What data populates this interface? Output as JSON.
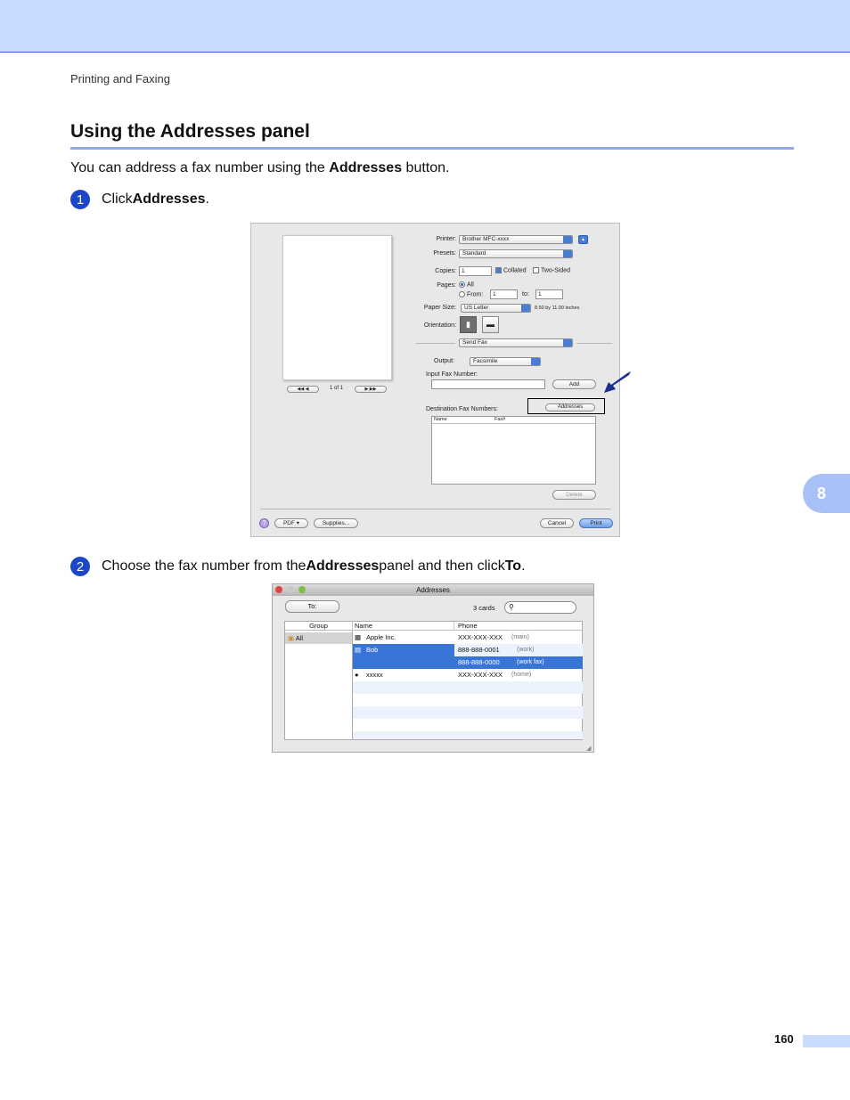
{
  "header": {
    "running_head": "Printing and Faxing"
  },
  "section": {
    "title": "Using the Addresses panel",
    "intro_pre": "You can address a fax number using the ",
    "intro_bold": "Addresses",
    "intro_post": " button."
  },
  "steps": [
    {
      "num": "1",
      "pre": "Click ",
      "bold": "Addresses",
      "post": "."
    },
    {
      "num": "2",
      "pre": "Choose the fax number from the ",
      "bold": "Addresses",
      "mid": " panel and then click ",
      "bold2": "To",
      "post": "."
    }
  ],
  "print_dialog": {
    "printer_label": "Printer:",
    "printer_value": "Brother MFC-xxxx",
    "presets_label": "Presets:",
    "presets_value": "Standard",
    "copies_label": "Copies:",
    "copies_value": "1",
    "collated": "Collated",
    "two_sided": "Two-Sided",
    "pages_label": "Pages:",
    "pages_all": "All",
    "pages_from": "From:",
    "from_value": "1",
    "to_label": "to:",
    "to_value": "1",
    "paper_label": "Paper Size:",
    "paper_value": "US Letter",
    "paper_dims": "8.50 by 11.00 inches",
    "orientation_label": "Orientation:",
    "send_fax": "Send Fax",
    "output_label": "Output:",
    "output_value": "Facsimile",
    "input_fax_label": "Input Fax Number:",
    "add_label": "Add",
    "dest_label": "Destination Fax Numbers:",
    "addresses_label": "Addresses",
    "col_name": "Name",
    "col_fax": "Fax#",
    "delete_label": "Delete",
    "page_count": "1 of 1",
    "help": "?",
    "pdf_label": "PDF ▾",
    "supplies_label": "Supplies...",
    "cancel_label": "Cancel",
    "print_label": "Print"
  },
  "addresses_panel": {
    "title": "Addresses",
    "to_label": "To:",
    "cards": "3 cards",
    "col_group": "Group",
    "col_name": "Name",
    "col_phone": "Phone",
    "group_all": "All",
    "rows": [
      {
        "name": "Apple Inc.",
        "phone": "XXX-XXX-XXX",
        "type": "(main)"
      },
      {
        "name": "Bob",
        "phone": "888-888-0001",
        "type": "(work)"
      },
      {
        "name": "",
        "phone": "888-888-0000",
        "type": "(work fax)"
      },
      {
        "name": "xxxxx",
        "phone": "XXX-XXX-XXX",
        "type": "(home)"
      }
    ]
  },
  "chapter_tab": "8",
  "page_number": "160",
  "colors": {
    "accent": "#1c46c8",
    "band": "#c9dbff",
    "tab": "#a8c2f8",
    "selection": "#3875d7"
  }
}
